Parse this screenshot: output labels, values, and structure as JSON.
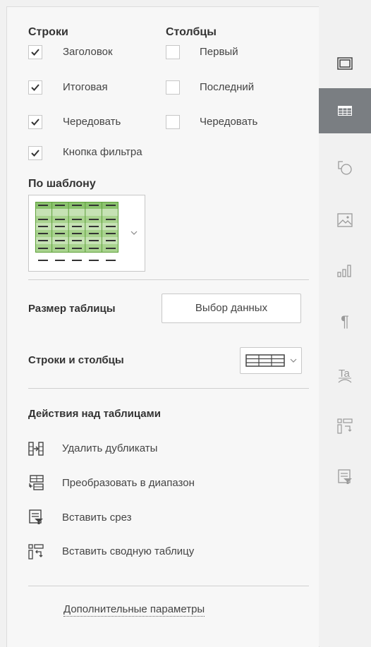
{
  "rows": {
    "title": "Строки",
    "items": [
      {
        "label": "Заголовок",
        "checked": true
      },
      {
        "label": "Итоговая",
        "checked": true
      },
      {
        "label": "Чередовать",
        "checked": true
      },
      {
        "label": "Кнопка фильтра",
        "checked": true
      }
    ]
  },
  "columns": {
    "title": "Столбцы",
    "items": [
      {
        "label": "Первый",
        "checked": false
      },
      {
        "label": "Последний",
        "checked": false
      },
      {
        "label": "Чередовать",
        "checked": false
      }
    ]
  },
  "template": {
    "title": "По шаблону"
  },
  "table_size": {
    "label": "Размер таблицы",
    "button": "Выбор данных"
  },
  "rows_cols": {
    "label": "Строки и столбцы"
  },
  "actions": {
    "title": "Действия над таблицами",
    "items": [
      {
        "label": "Удалить дубликаты",
        "icon": "remove-duplicates-icon"
      },
      {
        "label": "Преобразовать в диапазон",
        "icon": "convert-to-range-icon"
      },
      {
        "label": "Вставить срез",
        "icon": "insert-slicer-icon"
      },
      {
        "label": "Вставить сводную таблицу",
        "icon": "insert-pivot-icon"
      }
    ]
  },
  "advanced_link": "Дополнительные параметры",
  "rail": [
    "cell-settings-icon",
    "table-settings-icon",
    "shape-settings-icon",
    "image-settings-icon",
    "chart-settings-icon",
    "paragraph-settings-icon",
    "textart-settings-icon",
    "pivot-settings-icon",
    "slicer-settings-icon"
  ],
  "colors": {
    "accent_active": "#7a7e82",
    "template_green": "#8cc36f"
  }
}
